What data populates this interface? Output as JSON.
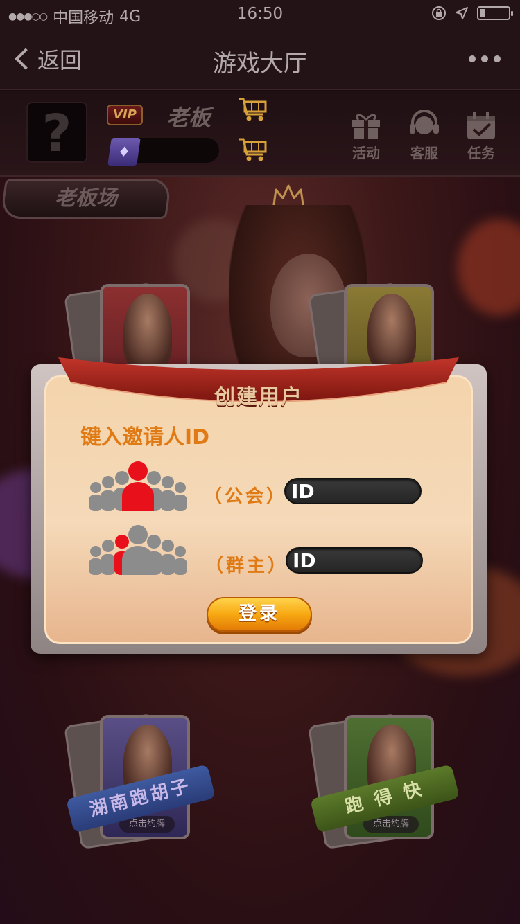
{
  "status_bar": {
    "carrier": "中国移动",
    "network": "4G",
    "time": "16:50",
    "signal_icon": "signal-dots-icon",
    "battery_level": 0.2
  },
  "nav": {
    "back_label": "返回",
    "title": "游戏大厅"
  },
  "header": {
    "vip_label": "VIP",
    "rank_label": "老板",
    "buttons": [
      {
        "label": "活动",
        "icon": "gift-icon"
      },
      {
        "label": "客服",
        "icon": "headset-icon"
      },
      {
        "label": "任务",
        "icon": "calendar-check-icon"
      }
    ]
  },
  "lobby": {
    "room_tab": "老板场",
    "cards": [
      {
        "ribbon": "湖南跑胡子",
        "tag": "点击约牌",
        "theme": "blue"
      },
      {
        "ribbon": "跑 得 快",
        "tag": "点击约牌",
        "theme": "green"
      }
    ]
  },
  "modal": {
    "title": "创建用户",
    "heading": "键入邀请人ID",
    "rows": [
      {
        "role": "（公会）",
        "prefix": "ID",
        "value": ""
      },
      {
        "role": "（群主）",
        "prefix": "ID",
        "value": ""
      }
    ],
    "login_label": "登录"
  },
  "colors": {
    "accent_orange": "#e07a14",
    "modal_bg": "#f3d4ac",
    "button_gold": "#f7a812",
    "ribbon_red": "#a9231a"
  }
}
